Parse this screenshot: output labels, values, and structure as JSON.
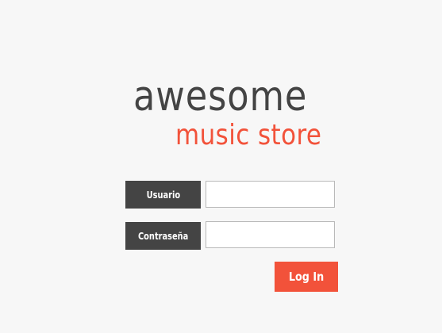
{
  "logo": {
    "line1": "awesome",
    "line2": "music store"
  },
  "form": {
    "username_label": "Usuario",
    "username_value": "",
    "password_label": "Contraseña",
    "password_value": "",
    "submit_label": "Log In"
  },
  "colors": {
    "accent": "#f2523a",
    "dark": "#444444",
    "background": "#f7f7f7"
  }
}
